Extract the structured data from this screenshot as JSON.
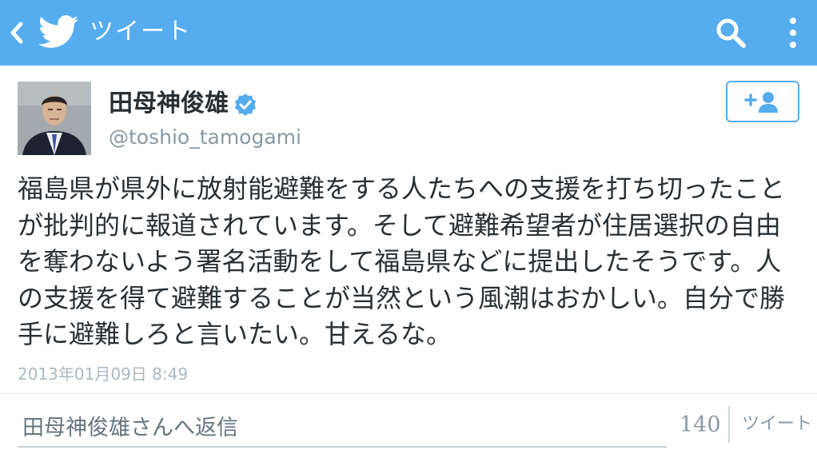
{
  "header": {
    "title": "ツイート",
    "back_icon": "chevron-left-icon",
    "logo_icon": "twitter-bird-icon",
    "search_icon": "search-icon",
    "menu_icon": "more-vertical-icon",
    "bar_color": "#55acee"
  },
  "tweet": {
    "author_name": "田母神俊雄",
    "handle": "@toshio_tamogami",
    "verified_icon": "verified-badge-icon",
    "follow_icon": "add-user-icon",
    "text": "福島県が県外に放射能避難をする人たちへの支援を打ち切ったことが批判的に報道されています。そして避難希望者が住居選択の自由を奪わないよう署名活動をして福島県などに提出したそうです。人の支援を得て避難することが当然という風潮はおかしい。自分で勝手に避難しろと言いたい。甘えるな。",
    "timestamp": "2013年01月09日 8:49"
  },
  "reply": {
    "placeholder": "田母神俊雄さんへ返信",
    "char_count": "140",
    "tweet_label": "ツイート"
  }
}
